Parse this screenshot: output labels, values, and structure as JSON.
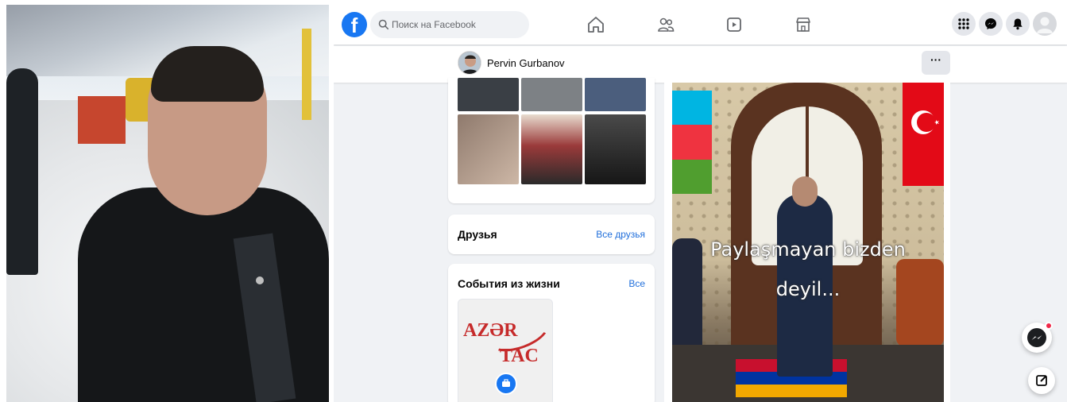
{
  "topbar": {
    "search_placeholder": "Поиск на Facebook",
    "nav": [
      "home-icon",
      "friends-icon",
      "watch-icon",
      "marketplace-icon"
    ],
    "right_buttons": [
      "menu-grid-icon",
      "messenger-icon",
      "notifications-icon",
      "account-icon"
    ]
  },
  "profile": {
    "name": "Pervin Gurbanov",
    "more_label": "···"
  },
  "friends_card": {
    "title": "Друзья",
    "link": "Все друзья"
  },
  "events_card": {
    "title": "События из жизни",
    "link": "Все",
    "logo_line1": "AZƏR",
    "logo_line2": "TAC"
  },
  "post": {
    "overlay_line1": "Paylaşmayan bizden",
    "overlay_line2": "deyil..."
  },
  "colors": {
    "facebook_blue": "#1877f2",
    "link_blue": "#216fdb",
    "background": "#f0f2f5",
    "notification_red": "#f02849"
  }
}
